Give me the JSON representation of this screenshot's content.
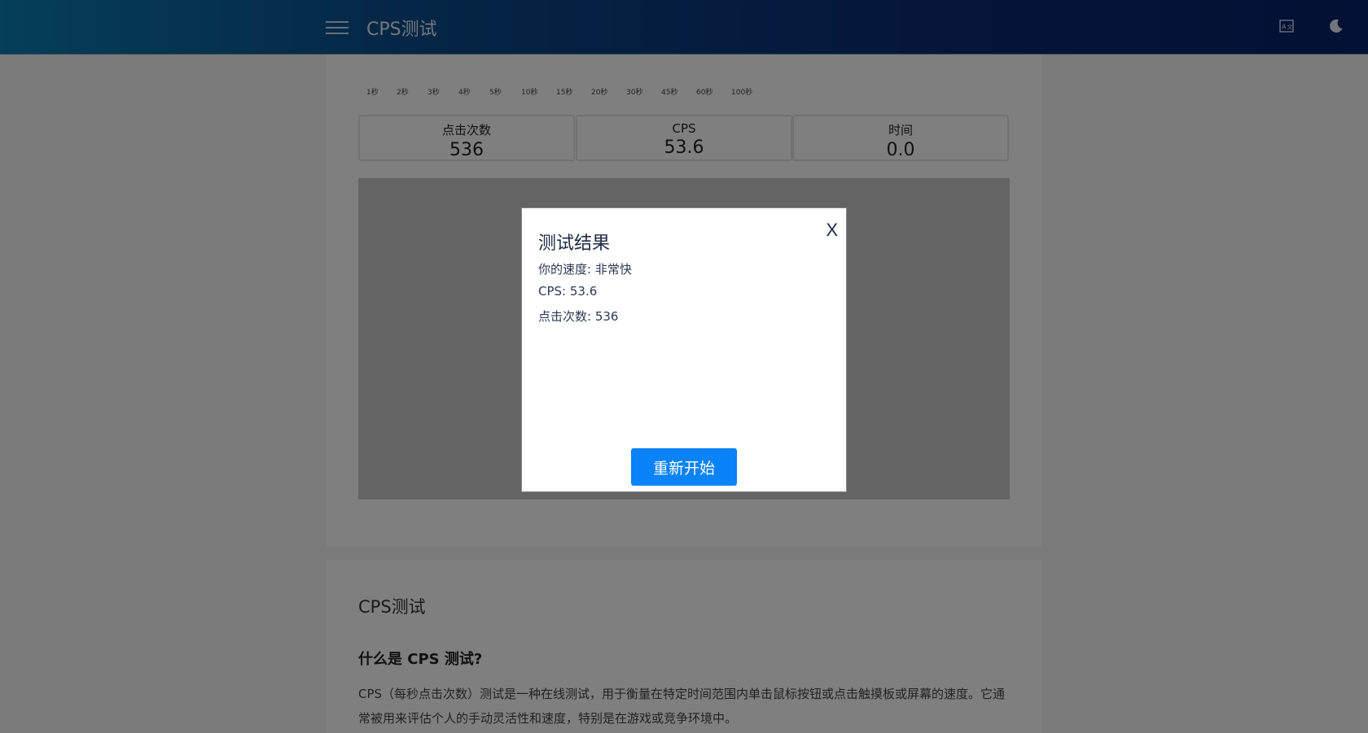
{
  "header": {
    "title": "CPS测试",
    "icons": {
      "menu": "hamburger-menu-icon",
      "language": "translate-icon",
      "theme": "moon-icon"
    }
  },
  "durations": [
    "1秒",
    "2秒",
    "3秒",
    "4秒",
    "5秒",
    "10秒",
    "15秒",
    "20秒",
    "30秒",
    "45秒",
    "60秒",
    "100秒"
  ],
  "stats": [
    {
      "label": "点击次数",
      "value": "536"
    },
    {
      "label": "CPS",
      "value": "53.6"
    },
    {
      "label": "时间",
      "value": "0.0"
    }
  ],
  "article": {
    "title": "CPS测试",
    "heading": "什么是 CPS 测试?",
    "paragraph": "CPS（每秒点击次数）测试是一种在线测试，用于衡量在特定时间范围内单击鼠标按钮或点击触摸板或屏幕的速度。它通常被用来评估个人的手动灵活性和速度，特别是在游戏或竞争环境中。"
  },
  "modal": {
    "title": "测试结果",
    "close_label": "X",
    "speed_line": "你的速度: 非常快",
    "cps_line": "CPS: 53.6",
    "clicks_line": "点击次数: 536",
    "restart_label": "重新开始"
  },
  "colors": {
    "header_start": "#0a7eb4",
    "header_end": "#06216a",
    "button": "#0a82f8",
    "overlay": "rgba(0,0,0,0.5)"
  }
}
